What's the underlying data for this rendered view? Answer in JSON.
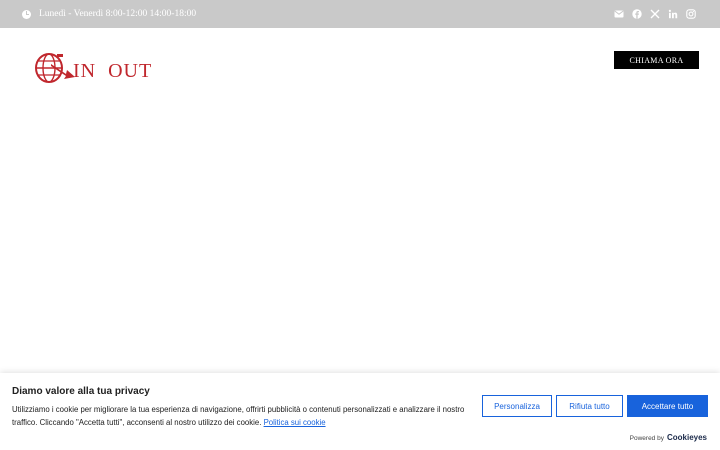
{
  "topbar": {
    "hours": "Lunedì - Venerdì 8:00-12:00 14:00-18:00",
    "background": "#c9c9c9",
    "social_icons": [
      "envelope-icon",
      "facebook-icon",
      "x-twitter-icon",
      "linkedin-icon",
      "instagram-icon"
    ]
  },
  "header": {
    "logo_text_1": "IN",
    "logo_text_2": "OUT",
    "call_button": "CHIAMA ORA",
    "brand_color": "#c0272d"
  },
  "cookie": {
    "title": "Diamo valore alla tua privacy",
    "text": "Utilizziamo i cookie per migliorare la tua esperienza di navigazione, offrirti pubblicità o contenuti personalizzati e analizzare il nostro traffico. Cliccando \"Accetta tutti\", acconsenti al nostro utilizzo dei cookie.",
    "policy_link": "Politica sui cookie",
    "customize_button": "Personalizza",
    "reject_button": "Rifiuta tutto",
    "accept_button": "Accettare tutto",
    "powered_by": "Powered by",
    "powered_brand": "Cookieyes",
    "accent": "#1863dc"
  }
}
